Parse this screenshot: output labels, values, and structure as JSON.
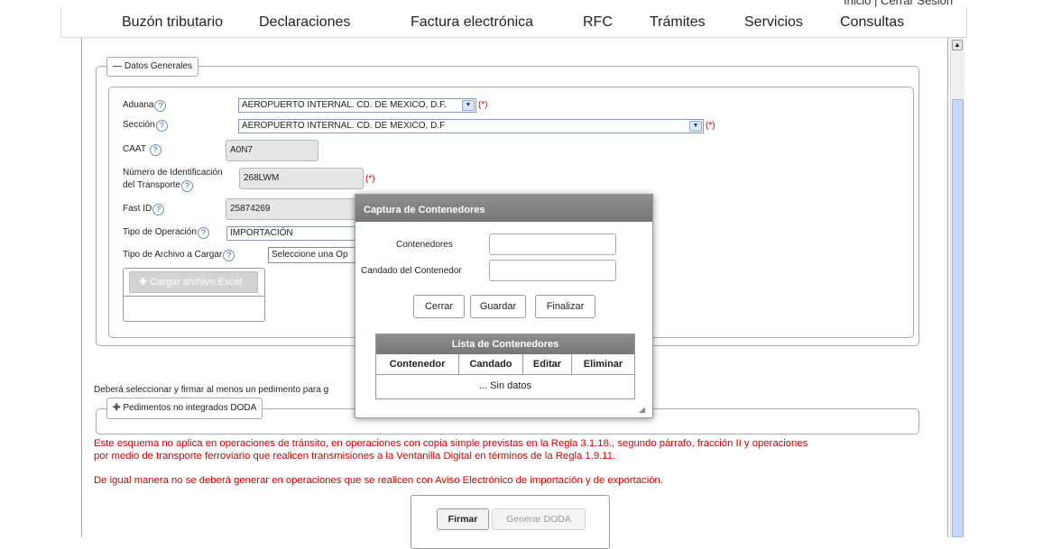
{
  "top_links": "Inicio | Cerrar Sesión",
  "nav": {
    "items": [
      "Buzón tributario",
      "Declaraciones",
      "Factura electrónica",
      "RFC",
      "Trámites",
      "Servicios",
      "Consultas"
    ]
  },
  "datos_generales": {
    "legend": "Datos Generales",
    "aduana": {
      "label": "Aduana",
      "value": "AEROPUERTO INTERNAL. CD. DE MEXICO, D.F.",
      "required": "(*)"
    },
    "seccion": {
      "label": "Sección",
      "value": "AEROPUERTO INTERNAL. CD. DE MEXICO, D.F",
      "required": "(*)"
    },
    "caat": {
      "label": "CAAT",
      "value": "A0N7"
    },
    "transporte": {
      "label_line1": "Número de Identificación",
      "label_line2": "del Transporte",
      "value": "268LWM",
      "required": "(*)"
    },
    "fast_id": {
      "label": "Fast ID",
      "value": "25874269"
    },
    "tipo_operacion": {
      "label": "Tipo de Operación",
      "value": "IMPORTACIÓN"
    },
    "tipo_archivo": {
      "label": "Tipo de Archivo a Cargar",
      "value": "Seleccione una Op"
    },
    "cargar_button": "Cargar archivo Excel"
  },
  "pedimentos": {
    "notice": "Deberá seleccionar y firmar al menos un pedimento para g",
    "legend": "Pedimentos no integrados DODA"
  },
  "warnings": {
    "line1": "Este esquema no aplica en operaciones de tránsito, en operaciones con copia simple previstas en la Regla 3.1.18., segundo párrafo, fracción II y operaciones",
    "line2": "por medio de transporte ferroviario que realicen transmisiones a la Ventanilla Digital en términos de la Regla 1.9.11.",
    "line3": "De igual manera no se deberá generar en operaciones que se realicen con Aviso Electrónico de importación y de exportación."
  },
  "actions": {
    "firmar": "Firmar",
    "generar": "Generar DODA"
  },
  "modal": {
    "title": "Captura de Contenedores",
    "contenedores_label": "Contenedores",
    "candado_label": "Candado del Contenedor",
    "buttons": {
      "cerrar": "Cerrar",
      "guardar": "Guardar",
      "finalizar": "Finalizar"
    },
    "table": {
      "title": "Lista de Contenedores",
      "columns": [
        "Contenedor",
        "Candado",
        "Editar",
        "Eliminar"
      ],
      "empty": "... Sin datos"
    }
  },
  "colors": {
    "required": "#d00000",
    "header_gray": "#808080",
    "warning_text": "#d00000"
  }
}
